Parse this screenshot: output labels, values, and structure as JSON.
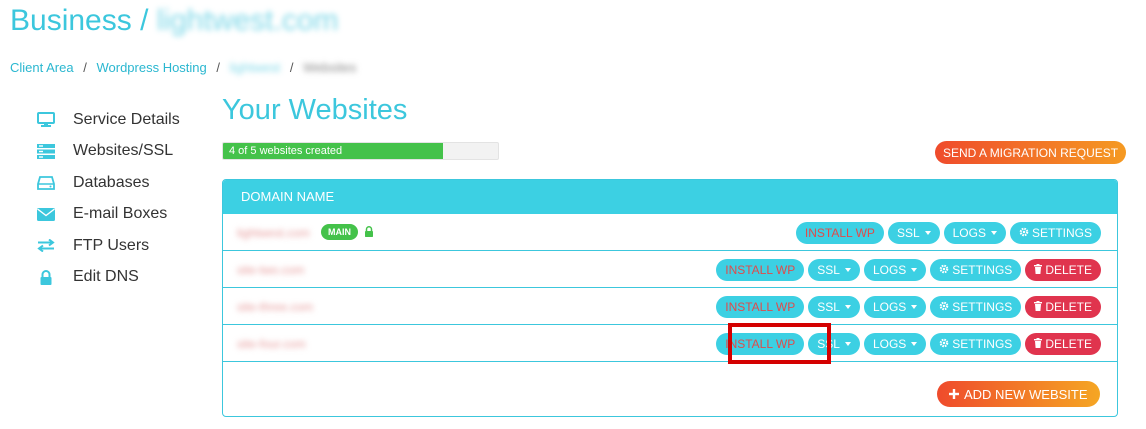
{
  "header": {
    "title": "Business",
    "title_sep": "/",
    "title_domain": "lightwest.com"
  },
  "breadcrumb": {
    "items": [
      "Client Area",
      "Wordpress Hosting"
    ],
    "blurred_a": "lightwest",
    "blurred_b": "Websites"
  },
  "sidebar": {
    "items": [
      {
        "label": "Service Details",
        "icon": "monitor-icon"
      },
      {
        "label": "Websites/SSL",
        "icon": "server-icon"
      },
      {
        "label": "Databases",
        "icon": "hard-drive-icon"
      },
      {
        "label": "E-mail Boxes",
        "icon": "envelope-icon"
      },
      {
        "label": "FTP Users",
        "icon": "exchange-arrows-icon"
      },
      {
        "label": "Edit DNS",
        "icon": "lock-icon"
      }
    ]
  },
  "main": {
    "title": "Your Websites",
    "progress": {
      "text": "4 of 5 websites created",
      "used": 4,
      "total": 5
    },
    "migration_button": "SEND A MIGRATION REQUEST",
    "table": {
      "header": "DOMAIN NAME",
      "main_badge": "MAIN",
      "rows": [
        {
          "domain": "lightwest.com",
          "is_main": true
        },
        {
          "domain": "site-two.com",
          "is_main": false
        },
        {
          "domain": "site-three.com",
          "is_main": false
        },
        {
          "domain": "site-four.com",
          "is_main": false
        }
      ],
      "actions": {
        "install_wp": "INSTALL WP",
        "ssl": "SSL",
        "logs": "LOGS",
        "settings": "SETTINGS",
        "delete": "DELETE"
      }
    },
    "add_button": "ADD NEW WEBSITE"
  },
  "colors": {
    "accent": "#3cc7dd",
    "progress_fill": "#44c24a",
    "danger": "#e0344e",
    "install_text": "#e04b4b",
    "highlight": "#d40000"
  }
}
